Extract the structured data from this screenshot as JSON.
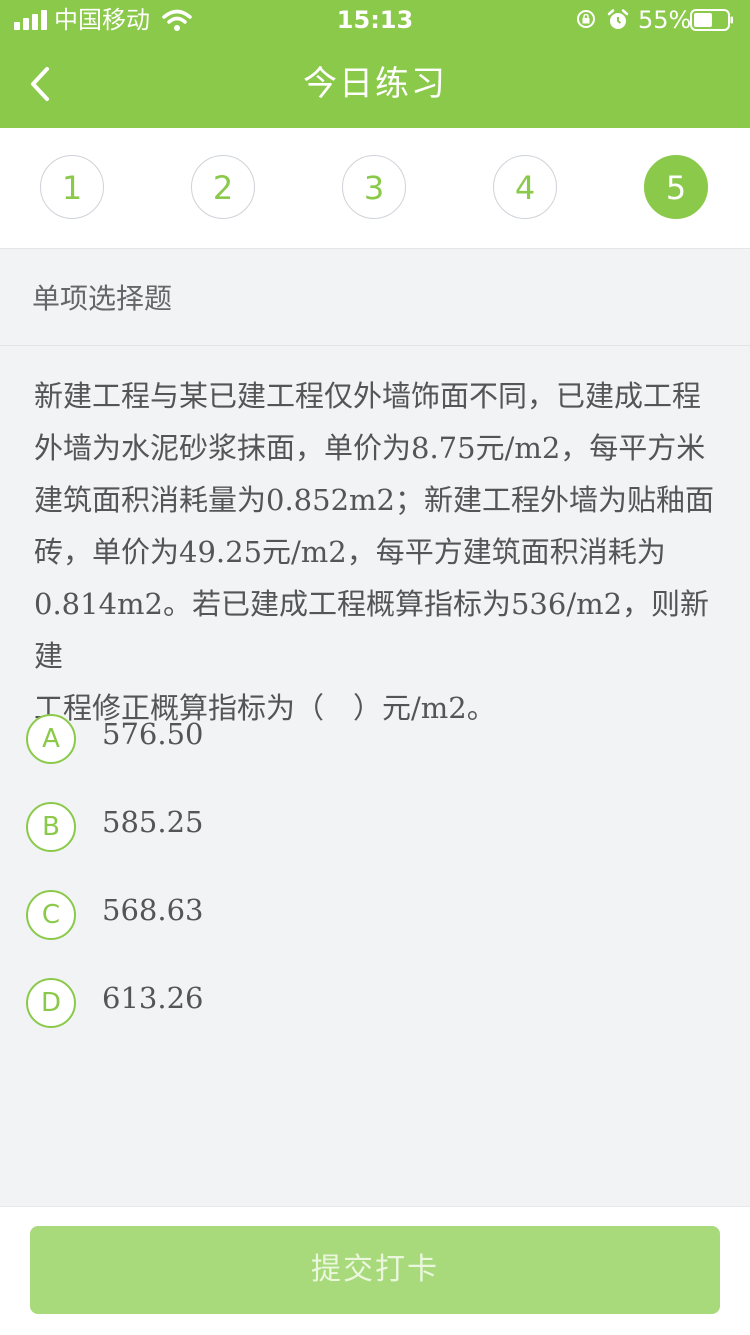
{
  "status_bar": {
    "carrier": "中国移动",
    "time": "15:13",
    "battery": "55%"
  },
  "nav": {
    "title": "今日练习",
    "back_icon": "chevron-left-icon"
  },
  "steps": [
    {
      "label": "1",
      "active": false
    },
    {
      "label": "2",
      "active": false
    },
    {
      "label": "3",
      "active": false
    },
    {
      "label": "4",
      "active": false
    },
    {
      "label": "5",
      "active": true
    }
  ],
  "question": {
    "type": "单项选择题",
    "lines": [
      "新建工程与某已建工程仅外墙饰面不同，已建成工程",
      "外墙为水泥砂浆抹面，单价为8.75元/m2，每平方米",
      "建筑面积消耗量为0.852m2；新建工程外墙为贴釉面",
      "砖，单价为49.25元/m2，每平方建筑面积消耗为",
      "0.814m2。若已建成工程概算指标为536/m2，则新建",
      "工程修正概算指标为（　）元/m2。"
    ],
    "options": [
      {
        "letter": "A",
        "text": "576.50"
      },
      {
        "letter": "B",
        "text": "585.25"
      },
      {
        "letter": "C",
        "text": "568.63"
      },
      {
        "letter": "D",
        "text": "613.26"
      }
    ]
  },
  "footer": {
    "submit_label": "提交打卡"
  },
  "colors": {
    "brand": "#8bc94a",
    "submit_disabled": "#a8da7c",
    "background": "#f2f3f5"
  }
}
